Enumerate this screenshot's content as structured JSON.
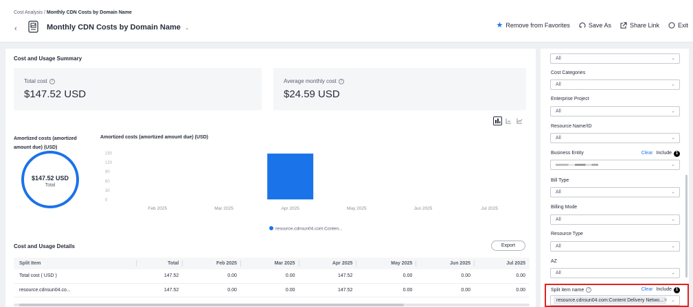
{
  "header": {
    "breadcrumb_root": "Cost Analysis /",
    "breadcrumb_current": "Monthly CDN Costs by Domain Name",
    "title": "Monthly CDN Costs by Domain Name",
    "actions": {
      "favorite": "Remove from Favorites",
      "save_as": "Save As",
      "share": "Share Link",
      "exit": "Exit"
    }
  },
  "summary": {
    "title": "Cost and Usage Summary",
    "total_label": "Total cost",
    "total_value": "$147.52 USD",
    "avg_label": "Average monthly cost",
    "avg_value": "$24.59 USD"
  },
  "donut": {
    "title": "Amortized costs (amortized amount due) (USD)",
    "value": "$147.52 USD",
    "caption": "Total"
  },
  "chart_data": {
    "type": "bar",
    "title": "Amortized costs (amortized amount due) (USD)",
    "categories": [
      "Feb 2025",
      "Mar 2025",
      "Apr 2025",
      "May 2025",
      "Jun 2025",
      "Jul 2025"
    ],
    "series": [
      {
        "name": "resource.cdnsun04.com:Conten...",
        "values": [
          0,
          0,
          147.52,
          0,
          0,
          0
        ]
      }
    ],
    "y_ticks": [
      "150",
      "120",
      "90",
      "60",
      "30",
      "0"
    ],
    "ylim": [
      0,
      150
    ],
    "grid": false,
    "legend": "bottom-center",
    "color": "#1a73e8"
  },
  "details": {
    "title": "Cost and Usage Details",
    "export": "Export",
    "columns": [
      "Split Item",
      "Total",
      "Feb 2025",
      "Mar 2025",
      "Apr 2025",
      "May 2025",
      "Jun 2025",
      "Jul 2025"
    ],
    "rows": [
      [
        "Total cost ( USD )",
        "147.52",
        "0.00",
        "0.00",
        "147.52",
        "0.00",
        "0.00",
        "0.00"
      ],
      [
        "resource.cdnsun04.co...",
        "147.52",
        "0.00",
        "0.00",
        "147.52",
        "0.00",
        "0.00",
        "0.00"
      ]
    ]
  },
  "filters": {
    "top_select": "All",
    "cost_categories": {
      "label": "Cost Categories",
      "value": "All"
    },
    "enterprise_project": {
      "label": "Enterprise Project",
      "value": "All"
    },
    "resource_name": {
      "label": "Resource Name/ID",
      "value": "All"
    },
    "business_entity": {
      "label": "Business Entity",
      "clear": "Clear",
      "include": "Include",
      "count": "1"
    },
    "bill_type": {
      "label": "Bill Type",
      "value": "All"
    },
    "billing_mode": {
      "label": "Billing Mode",
      "value": "All"
    },
    "resource_type": {
      "label": "Resource Type",
      "value": "All"
    },
    "az": {
      "label": "AZ",
      "value": "All"
    },
    "split_item": {
      "label": "Split item name",
      "clear": "Clear",
      "include": "Include",
      "count": "1",
      "tag": "resource.cdnsun04.com:Content Delivery Netwo..."
    }
  },
  "colors": {
    "accent": "#1a73e8",
    "highlight": "#e02020"
  }
}
